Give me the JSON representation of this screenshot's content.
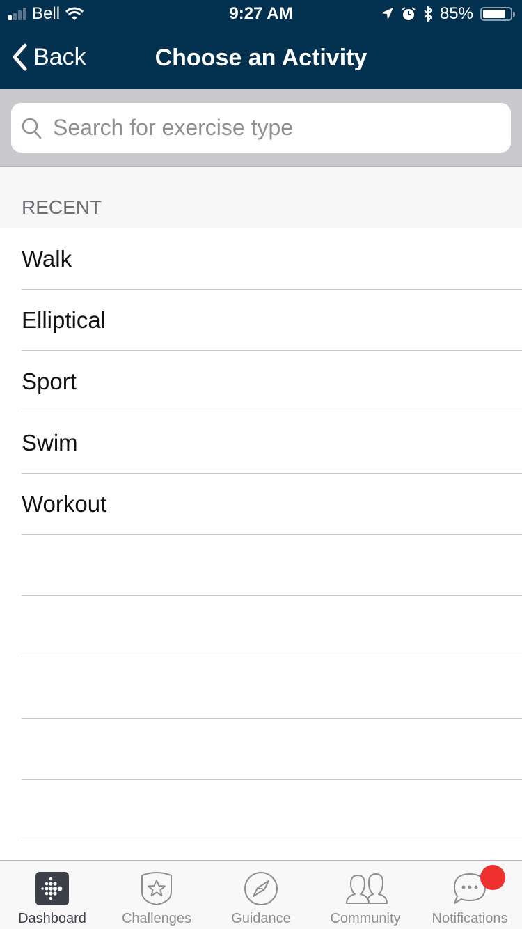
{
  "status_bar": {
    "carrier": "Bell",
    "time": "9:27 AM",
    "battery_percent": "85%",
    "battery_level": 0.85,
    "signal_bars_active": 1,
    "signal_bars_total": 4,
    "icons": [
      "signal-icon",
      "wifi-icon",
      "location-icon",
      "alarm-icon",
      "bluetooth-icon",
      "battery-icon"
    ]
  },
  "nav": {
    "back_label": "Back",
    "title": "Choose an Activity"
  },
  "search": {
    "placeholder": "Search for exercise type",
    "value": ""
  },
  "recent": {
    "header": "RECENT",
    "items": [
      "Walk",
      "Elliptical",
      "Sport",
      "Swim",
      "Workout",
      "",
      "",
      "",
      "",
      ""
    ]
  },
  "tabbar": {
    "items": [
      {
        "label": "Dashboard",
        "icon": "dashboard-icon",
        "active": true
      },
      {
        "label": "Challenges",
        "icon": "challenges-icon",
        "active": false
      },
      {
        "label": "Guidance",
        "icon": "compass-icon",
        "active": false
      },
      {
        "label": "Community",
        "icon": "community-icon",
        "active": false
      },
      {
        "label": "Notifications",
        "icon": "notifications-icon",
        "active": false,
        "badge": true
      }
    ]
  },
  "colors": {
    "header_bg": "#02304f",
    "badge": "#f0302e",
    "search_bar_bg": "#c8c8cd"
  }
}
